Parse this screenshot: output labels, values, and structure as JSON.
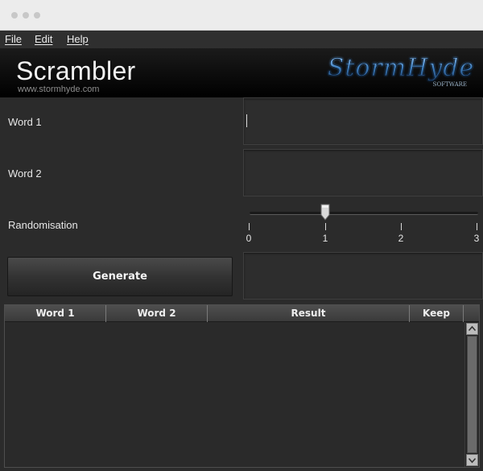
{
  "window": {
    "title_dots": 3
  },
  "menu": [
    {
      "label": "File"
    },
    {
      "label": "Edit"
    },
    {
      "label": "Help"
    }
  ],
  "banner": {
    "title": "Scrambler",
    "url": "www.stormhyde.com",
    "logo_text": "StormHyde",
    "logo_sub": "SOFTWARE"
  },
  "form": {
    "word1_label": "Word 1",
    "word2_label": "Word 2",
    "randomisation_label": "Randomisation",
    "word1_value": "",
    "word2_value": "",
    "result_value": ""
  },
  "slider": {
    "min": 0,
    "max": 3,
    "value": 1,
    "ticks": [
      "0",
      "1",
      "2",
      "3"
    ]
  },
  "generate_label": "Generate",
  "table": {
    "columns": [
      "Word 1",
      "Word 2",
      "Result",
      "Keep"
    ],
    "rows": []
  },
  "colors": {
    "background": "#2b2b2b",
    "banner": "#000000",
    "logo_glow": "#6fa8d8"
  }
}
